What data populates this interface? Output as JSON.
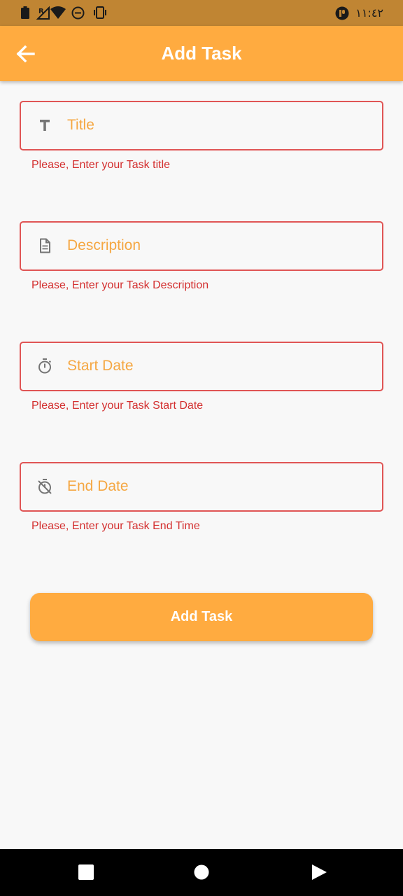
{
  "status_bar": {
    "time": "١١:٤٢",
    "icons": [
      "battery-icon",
      "no-signal-icon",
      "wifi-icon",
      "do-not-disturb-icon",
      "vibrate-icon",
      "app-notification-icon"
    ]
  },
  "app_bar": {
    "title": "Add Task",
    "back_icon": "arrow-back-icon"
  },
  "form": {
    "fields": [
      {
        "placeholder": "Title",
        "icon": "title-icon",
        "error": "Please, Enter your Task title"
      },
      {
        "placeholder": "Description",
        "icon": "description-icon",
        "error": "Please, Enter your Task Description"
      },
      {
        "placeholder": "Start Date",
        "icon": "timer-icon",
        "error": "Please, Enter your Task Start Date"
      },
      {
        "placeholder": "End Date",
        "icon": "timer-off-icon",
        "error": "Please, Enter your Task End Time"
      }
    ],
    "submit_label": "Add Task"
  },
  "nav_bar": {
    "buttons": [
      "recents-icon",
      "home-icon",
      "back-triangle-icon"
    ]
  },
  "colors": {
    "accent": "#ffab40",
    "status_bar": "#c08533",
    "error": "#d32f2f",
    "border_error": "#e05555",
    "placeholder": "#f5a742",
    "background": "#f8f8f8"
  }
}
